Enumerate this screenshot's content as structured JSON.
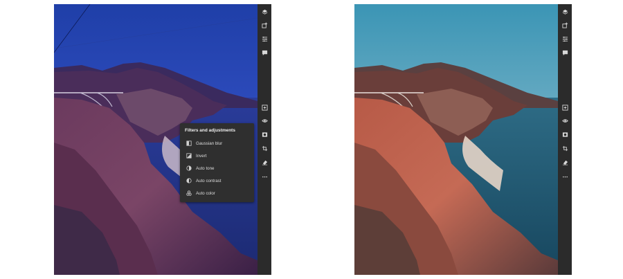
{
  "menu": {
    "title": "Filters and adjustments",
    "items": [
      {
        "label": "Gaussian blur",
        "icon": "gaussian-blur-icon"
      },
      {
        "label": "Invert",
        "icon": "invert-icon"
      },
      {
        "label": "Auto tone",
        "icon": "auto-tone-icon"
      },
      {
        "label": "Auto contrast",
        "icon": "auto-contrast-icon"
      },
      {
        "label": "Auto color",
        "icon": "auto-color-icon"
      }
    ]
  },
  "rail_icons": [
    "layers-icon",
    "add-layer-icon",
    "adjustments-icon",
    "comments-icon",
    "filters-icon",
    "visibility-icon",
    "mask-icon",
    "crop-icon",
    "eraser-icon",
    "more-icon"
  ],
  "colors": {
    "rail": "#2b2b2b",
    "menu_bg": "#2f2f2f",
    "menu_text": "#dcdcdc"
  }
}
